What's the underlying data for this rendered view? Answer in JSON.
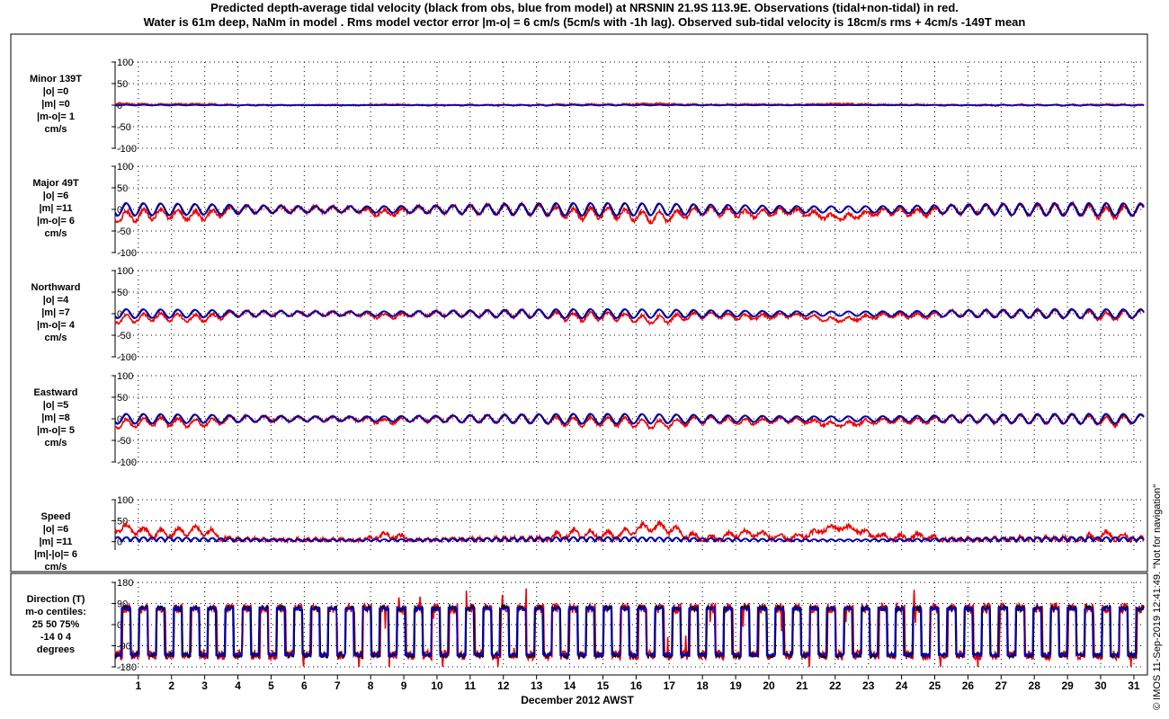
{
  "title_lines": [
    "Predicted depth-average tidal velocity (black from obs, blue from model) at NRSNIN 21.9S 113.9E. Observations (tidal+non-tidal) in red.",
    "Water is 61m deep, NaNm in model . Rms model vector error |m-o| = 6 cm/s (5cm/s with -1h lag). Observed sub-tidal velocity is 18cm/s rms + 4cm/s -149T mean"
  ],
  "credit": "© IMOS 11-Sep-2019 12:41:49. \"Not for navigation\"",
  "colors": {
    "obs_tidal": "#000000",
    "model": "#0000cc",
    "observed": "#ee0000",
    "grid": "#000000"
  },
  "chart_data": {
    "type": "line",
    "xlabel": "December 2012 AWST",
    "x_ticks": [
      1,
      2,
      3,
      4,
      5,
      6,
      7,
      8,
      9,
      10,
      11,
      12,
      13,
      14,
      15,
      16,
      17,
      18,
      19,
      20,
      21,
      22,
      23,
      24,
      25,
      26,
      27,
      28,
      29,
      30,
      31
    ],
    "xlim": [
      0.3,
      31.3
    ],
    "series_legend": {
      "black": "from obs",
      "blue": "from model",
      "red": "Observations (tidal+non-tidal)"
    },
    "panels": [
      {
        "id": "minor",
        "label_lines": [
          "Minor 139T",
          "|o| =0",
          "|m| =0",
          "|m-o|= 1",
          "cm/s"
        ],
        "ylim": [
          -100,
          100
        ],
        "yticks": [
          "100",
          "50",
          "0",
          "-50",
          "-100"
        ],
        "tidal_amp": 1,
        "obs_offset": 2,
        "obs_noise": 3
      },
      {
        "id": "major",
        "label_lines": [
          "Major 49T",
          "|o| =6",
          "|m| =11",
          "|m-o|= 6",
          "cm/s"
        ],
        "ylim": [
          -100,
          100
        ],
        "yticks": [
          "100",
          "50",
          "0",
          "-50",
          "-100"
        ],
        "tidal_amp": 14,
        "obs_offset": -12,
        "obs_noise": 8
      },
      {
        "id": "north",
        "label_lines": [
          "Northward",
          "|o| =4",
          "|m| =7",
          "|m-o|= 4",
          "cm/s"
        ],
        "ylim": [
          -100,
          100
        ],
        "yticks": [
          "100",
          "50",
          "0",
          "-50",
          "-100"
        ],
        "tidal_amp": 10,
        "obs_offset": -9,
        "obs_noise": 6
      },
      {
        "id": "east",
        "label_lines": [
          "Eastward",
          "|o| =5",
          "|m| =8",
          "|m-o|= 5",
          "cm/s"
        ],
        "ylim": [
          -100,
          100
        ],
        "yticks": [
          "100",
          "50",
          "0",
          "-50",
          "-100"
        ],
        "tidal_amp": 11,
        "obs_offset": -8,
        "obs_noise": 6
      },
      {
        "id": "speed",
        "label_lines": [
          "Speed",
          "|o| =6",
          "|m| =11",
          "|m|-|o|= 6",
          "cm/s"
        ],
        "ylim": [
          -20,
          100
        ],
        "yticks": [
          "100",
          "50",
          "0"
        ],
        "tidal_amp": 11,
        "obs_offset": 22,
        "obs_noise": 10
      },
      {
        "id": "direction",
        "label_lines": [
          "Direction (T)",
          "m-o centiles:",
          "25  50  75%",
          "-14   0   4",
          "degrees"
        ],
        "ylim": [
          -180,
          180
        ],
        "yticks": [
          "180",
          "90",
          "0",
          "-90",
          "-180"
        ]
      }
    ]
  }
}
